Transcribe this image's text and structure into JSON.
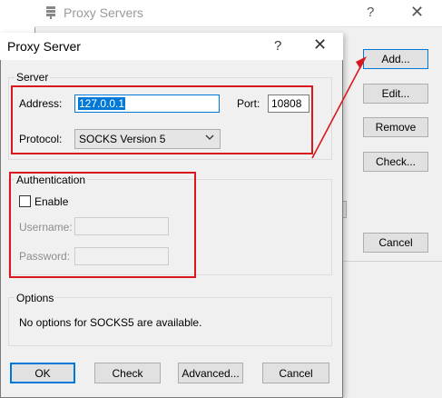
{
  "background_window": {
    "title": "Proxy Servers",
    "help_glyph": "?",
    "close_glyph": "✕",
    "buttons": {
      "add": "Add...",
      "edit": "Edit...",
      "remove": "Remove",
      "check": "Check...",
      "cancel": "Cancel"
    }
  },
  "dialog": {
    "title": "Proxy Server",
    "help_glyph": "?",
    "close_glyph": "✕",
    "server": {
      "group_label": "Server",
      "address_label": "Address:",
      "address_value": "127.0.0.1",
      "port_label": "Port:",
      "port_value": "10808",
      "protocol_label": "Protocol:",
      "protocol_value": "SOCKS Version 5"
    },
    "auth": {
      "group_label": "Authentication",
      "enable_label": "Enable",
      "enable_checked": false,
      "username_label": "Username:",
      "password_label": "Password:"
    },
    "options": {
      "group_label": "Options",
      "text": "No options for SOCKS5 are available."
    },
    "buttons": {
      "ok": "OK",
      "check": "Check",
      "advanced": "Advanced...",
      "cancel": "Cancel"
    }
  },
  "colors": {
    "annotation_red": "#d9171e",
    "focus_blue": "#0078d7"
  },
  "icons": {
    "background_window_icon": "proxy-server-icon",
    "combo_arrow": "chevron-down-icon"
  }
}
